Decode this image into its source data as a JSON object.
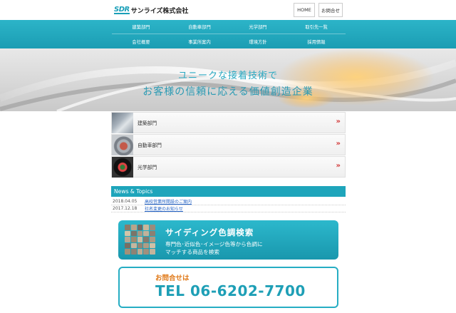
{
  "header": {
    "logo_mark": "SDR",
    "logo_text": "サンライズ株式会社",
    "home_label": "HOME",
    "contact_label": "お問合せ"
  },
  "nav": {
    "items": [
      "建築部門",
      "自動車部門",
      "光学部門",
      "取引先一覧",
      "会社概要",
      "事業所案内",
      "環境方針",
      "採用情報"
    ]
  },
  "hero": {
    "line1": "ユニークな接着技術で",
    "line2": "お客様の信頼に応える価値創造企業"
  },
  "divisions": [
    {
      "label": "建築部門",
      "chevron": "»"
    },
    {
      "label": "自動車部門",
      "chevron": "»"
    },
    {
      "label": "光学部門",
      "chevron": "»"
    }
  ],
  "news": {
    "heading": "News & Topics",
    "items": [
      {
        "date": "2018.04.05",
        "title": "高校営業所開設のご案内"
      },
      {
        "date": "2017.12.18",
        "title": "社名変更のお知らせ"
      }
    ]
  },
  "siding": {
    "title": "サイディング色調検索",
    "sub1": "専門色･近似色･イメージ色等から色調に",
    "sub2": "マッチする商品を検索",
    "swatch_colors": [
      "#8a7a6a",
      "#b8a48a",
      "#6e6a64",
      "#c9b79a",
      "#9a8c7c",
      "#d4c4a8",
      "#7c7468",
      "#a89884",
      "#c2b29a",
      "#8c8072",
      "#b4a896",
      "#9c8a72",
      "#ccbca4",
      "#847a6e",
      "#aa9a86",
      "#7a6e62",
      "#c6b69e",
      "#948676",
      "#b09c84",
      "#d0c0a6",
      "#a29078",
      "#8e8274",
      "#bcac94",
      "#9e907e",
      "#c4b49c"
    ]
  },
  "contact": {
    "label": "お問合せは",
    "tel": "TEL 06-6202-7700"
  },
  "colors": {
    "teal": "#1ea5bb",
    "chevron_red": "#d23b3b",
    "contact_orange": "#e07a1a",
    "link_blue": "#1f5fc4"
  }
}
